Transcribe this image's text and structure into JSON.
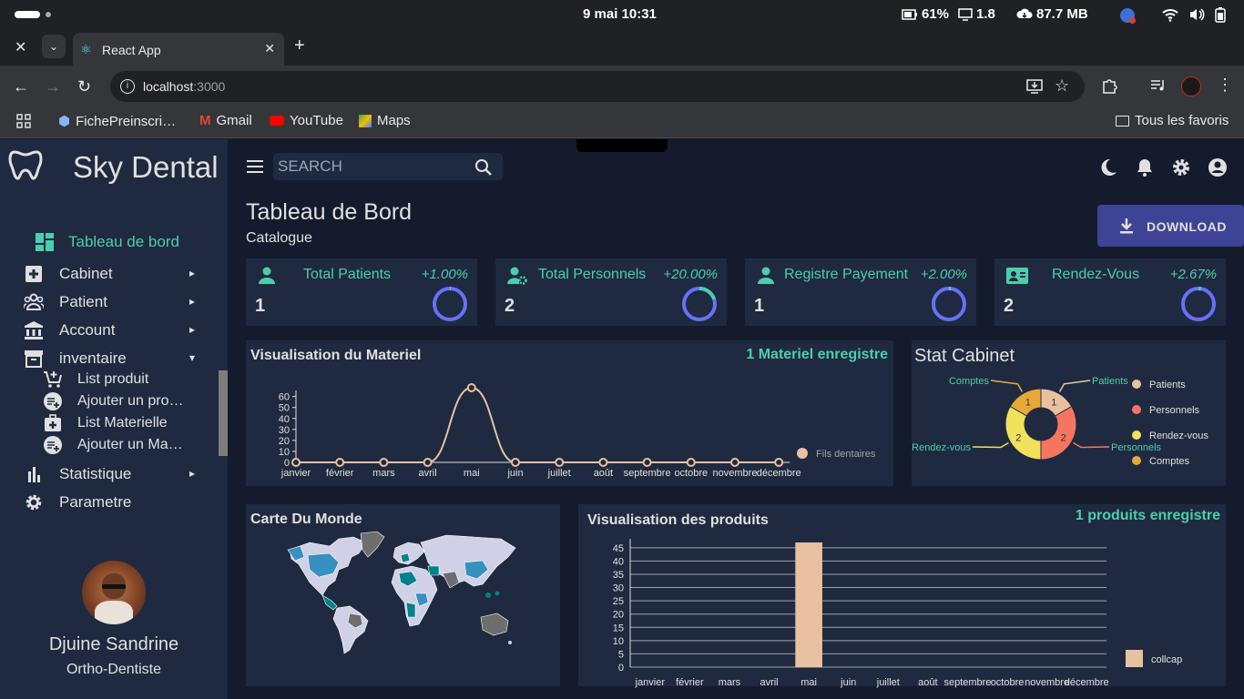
{
  "os": {
    "date_time": "9 mai  10:31",
    "battery": "61%",
    "load": "1.8",
    "memory": "87.7 MB"
  },
  "browser": {
    "tab_title": "React App",
    "url_host": "localhost",
    "url_port": ":3000",
    "bookmarks": [
      "FichePreinscri…",
      "Gmail",
      "YouTube",
      "Maps"
    ],
    "all_bookmarks": "Tous les favoris"
  },
  "sidebar": {
    "brand": "Sky Dental",
    "items": [
      {
        "label": "Tableau de bord",
        "icon": "dashboard-icon",
        "active": true
      },
      {
        "label": "Cabinet",
        "icon": "medical-cross-icon"
      },
      {
        "label": "Patient",
        "icon": "people-icon"
      },
      {
        "label": "Account",
        "icon": "bank-icon"
      },
      {
        "label": "inventaire",
        "icon": "archive-icon",
        "expanded": true
      },
      {
        "label": "Statistique",
        "icon": "bar-chart-icon"
      },
      {
        "label": "Parametre",
        "icon": "gear-icon"
      }
    ],
    "subitems": [
      {
        "label": "List produit",
        "icon": "cart-add-icon"
      },
      {
        "label": "Ajouter un pro…",
        "icon": "playlist-add-icon"
      },
      {
        "label": "List Materielle",
        "icon": "medical-kit-icon"
      },
      {
        "label": "Ajouter un Ma…",
        "icon": "playlist-add-icon"
      }
    ],
    "user_name": "Djuine Sandrine",
    "user_role": "Ortho-Dentiste"
  },
  "topbar": {
    "search_placeholder": "SEARCH"
  },
  "header": {
    "title": "Tableau de Bord",
    "subtitle": "Catalogue",
    "download": "DOWNLOAD"
  },
  "cards": [
    {
      "title": "Total Patients",
      "pct": "+1.00%",
      "value": "1",
      "progress": 0.01
    },
    {
      "title": "Total Personnels",
      "pct": "+20.00%",
      "value": "2",
      "progress": 0.2
    },
    {
      "title": "Registre Payement",
      "pct": "+2.00%",
      "value": "1",
      "progress": 0.02
    },
    {
      "title": "Rendez-Vous",
      "pct": "+2.67%",
      "value": "2",
      "progress": 0.0267
    }
  ],
  "colors": {
    "accent": "#4cceac",
    "ring_track": "#6870fa",
    "panel": "#1f2a40",
    "bg": "#141b2d",
    "button": "#3e4396"
  },
  "materiel_panel": {
    "title": "Visualisation du Materiel",
    "meta": "1 Materiel enregistre"
  },
  "stat_panel": {
    "title": "Stat Cabinet"
  },
  "map_panel": {
    "title": "Carte Du Monde"
  },
  "produits_panel": {
    "title": "Visualisation des produits",
    "meta": "1 produits enregistre"
  },
  "chart_data": [
    {
      "type": "line",
      "categories": [
        "janvier",
        "février",
        "mars",
        "avril",
        "mai",
        "juin",
        "juillet",
        "août",
        "septembre",
        "octobre",
        "novembre",
        "décembre"
      ],
      "series": [
        {
          "name": "Fils dentaires",
          "values": [
            0,
            0,
            0,
            0,
            68,
            0,
            0,
            0,
            0,
            0,
            0,
            0
          ],
          "color": "#e8c1a0"
        }
      ],
      "yticks": [
        0,
        10,
        20,
        30,
        40,
        50,
        60
      ],
      "ylim": [
        0,
        68
      ]
    },
    {
      "type": "pie",
      "labels": [
        "Patients",
        "Personnels",
        "Rendez-vous",
        "Comptes"
      ],
      "values": [
        1,
        2,
        2,
        1
      ],
      "colors": [
        "#e8c1a0",
        "#f47560",
        "#f1e15b",
        "#e8a838"
      ]
    },
    {
      "type": "bar",
      "categories": [
        "janvier",
        "février",
        "mars",
        "avril",
        "mai",
        "juin",
        "juillet",
        "août",
        "septembre",
        "octobre",
        "novembre",
        "décembre"
      ],
      "series": [
        {
          "name": "collcap",
          "values": [
            0,
            0,
            0,
            0,
            47,
            0,
            0,
            0,
            0,
            0,
            0,
            0
          ],
          "color": "#e8c1a0"
        }
      ],
      "yticks": [
        0,
        5,
        10,
        15,
        20,
        25,
        30,
        35,
        40,
        45
      ],
      "ylim": [
        0,
        47
      ]
    }
  ]
}
